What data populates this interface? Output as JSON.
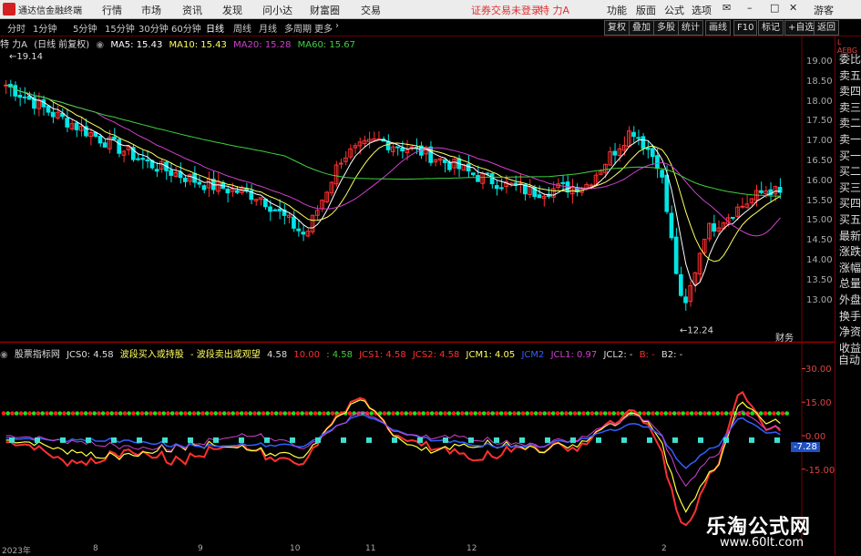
{
  "menu": {
    "app_name": "通达信金融终端",
    "items": [
      "行情",
      "市场",
      "资讯",
      "发现",
      "问小达",
      "财富圈",
      "交易"
    ],
    "login_status": "证券交易未登录",
    "stock_title": "特 力A",
    "right_items": [
      "功能",
      "版面",
      "公式",
      "选项"
    ],
    "guest": "游客"
  },
  "periods": [
    "分时",
    "1分钟",
    "5分钟",
    "15分钟",
    "30分钟",
    "60分钟",
    "日线",
    "周线",
    "月线",
    "多周期",
    "更多"
  ],
  "active_period": "日线",
  "toolbar": [
    "复权",
    "叠加",
    "多股",
    "统计",
    "画线",
    "F10",
    "标记",
    "+自选",
    "返回"
  ],
  "info": {
    "name": "特 力A",
    "mode": "(日线 前复权)",
    "ma5": "MA5: 15.43",
    "ma10": "MA10: 15.43",
    "ma20": "MA20: 15.28",
    "ma60": "MA60: 15.67"
  },
  "price_axis": [
    "19.00",
    "18.50",
    "18.00",
    "17.50",
    "17.00",
    "16.50",
    "16.00",
    "15.50",
    "15.00",
    "14.50",
    "14.00",
    "13.50",
    "13.00"
  ],
  "high_label": "19.14",
  "low_label": "12.24",
  "marker_label": "财务",
  "indicator_info": {
    "name": "股票指标网",
    "jcs0": "JCS0: 4.58",
    "buy": "波段买入或持股",
    "sell": "- 波段卖出或观望",
    "v1": "4.58",
    "v2": "10.00",
    "v3": ": 4.58",
    "jcs1": "JCS1: 4.58",
    "jcs2": "JCS2: 4.58",
    "jcm1": "JCM1: 4.05",
    "jcm2": "JCM2",
    "jcl1": "JCL1: 0.97",
    "jcl2": "JCL2: -",
    "b": "B: -",
    "b2": "B2: -"
  },
  "indicator_axis": [
    "30.00",
    "15.00",
    "0.00",
    "-15.00"
  ],
  "indicator_current": "-7.28",
  "x_axis": [
    "2023年",
    "8",
    "9",
    "10",
    "11",
    "12",
    "2"
  ],
  "right_panel": [
    "委比",
    "卖五",
    "卖四",
    "卖三",
    "卖二",
    "卖一",
    "买一",
    "买二",
    "买三",
    "买四",
    "买五",
    "最新",
    "涨跌",
    "涨幅",
    "总量",
    "外盘",
    "换手",
    "净资",
    "收益"
  ],
  "right_bottom": "自动",
  "watermark": "乐淘公式网",
  "watermark_url": "www.60lt.com",
  "colors": {
    "up": "#ff3030",
    "down": "#00e5e5",
    "ma5": "#ffffff",
    "ma10": "#ffff60",
    "ma20": "#d040d0",
    "ma60": "#40d040"
  }
}
